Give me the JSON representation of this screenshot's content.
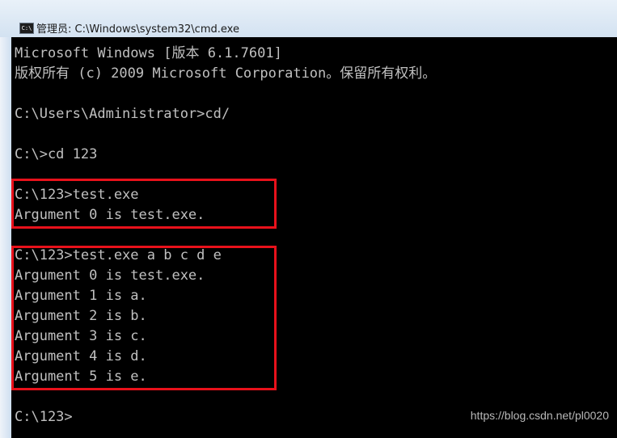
{
  "window": {
    "title": "管理员: C:\\Windows\\system32\\cmd.exe",
    "icon": "cmd-icon",
    "icon_text": "C:\\"
  },
  "console": {
    "lines": [
      "Microsoft Windows [版本 6.1.7601]",
      "版权所有 (c) 2009 Microsoft Corporation。保留所有权利。",
      "",
      "C:\\Users\\Administrator>cd/",
      "",
      "C:\\>cd 123",
      "",
      "C:\\123>test.exe",
      "Argument 0 is test.exe.",
      "",
      "C:\\123>test.exe a b c d e",
      "Argument 0 is test.exe.",
      "Argument 1 is a.",
      "Argument 2 is b.",
      "Argument 3 is c.",
      "Argument 4 is d.",
      "Argument 5 is e.",
      "",
      "C:\\123>"
    ]
  },
  "watermark": "https://blog.csdn.net/pl0020",
  "colors": {
    "console_bg": "#000000",
    "console_text": "#c0c0c0",
    "highlight": "#e8111b"
  }
}
